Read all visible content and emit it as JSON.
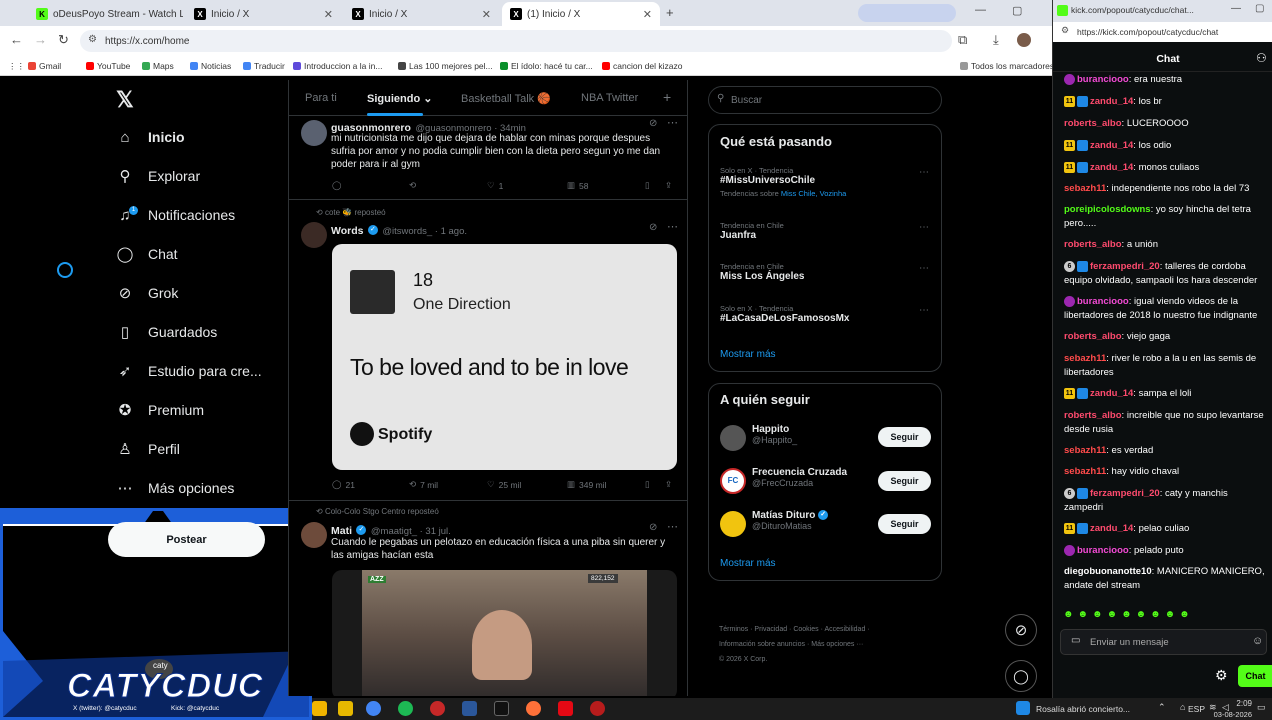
{
  "browser": {
    "tabs": [
      {
        "label": "oDeusPoyo Stream - Watch Liv",
        "color": "#53fc18",
        "glyph": "K"
      },
      {
        "label": "Inicio / X",
        "color": "#000000",
        "glyph": "X"
      },
      {
        "label": "Inicio / X",
        "color": "#000000",
        "glyph": "X"
      },
      {
        "label": "(1) Inicio / X",
        "color": "#000000",
        "glyph": "X"
      }
    ],
    "url": "https://x.com/home",
    "bookmarks": [
      {
        "label": "Gmail",
        "color": "#ea4335"
      },
      {
        "label": "YouTube",
        "color": "#ff0000"
      },
      {
        "label": "Maps",
        "color": "#34a853"
      },
      {
        "label": "Noticias",
        "color": "#4285f4"
      },
      {
        "label": "Traducir",
        "color": "#4285f4"
      },
      {
        "label": "Introduccion a la in...",
        "color": "#5f4bdb"
      },
      {
        "label": "Las 100 mejores pel...",
        "color": "#444444"
      },
      {
        "label": "El ídolo: hacé tu car...",
        "color": "#0a8f2a"
      },
      {
        "label": "cancion del kizazo",
        "color": "#ff0000"
      }
    ],
    "bookmarks_all": "Todos los marcadores"
  },
  "x_nav": {
    "items": [
      {
        "label": "Inicio",
        "icon": "home-icon",
        "glyph": "⌂"
      },
      {
        "label": "Explorar",
        "icon": "search-icon",
        "glyph": "⚲"
      },
      {
        "label": "Notificaciones",
        "icon": "bell-icon",
        "glyph": "♫"
      },
      {
        "label": "Chat",
        "icon": "chat-icon",
        "glyph": "◯"
      },
      {
        "label": "Grok",
        "icon": "grok-icon",
        "glyph": "⊘"
      },
      {
        "label": "Guardados",
        "icon": "bookmark-icon",
        "glyph": "▯"
      },
      {
        "label": "Estudio para cre...",
        "icon": "rocket-icon",
        "glyph": "➶"
      },
      {
        "label": "Premium",
        "icon": "premium-icon",
        "glyph": "✪"
      },
      {
        "label": "Perfil",
        "icon": "profile-icon",
        "glyph": "♙"
      },
      {
        "label": "Más opciones",
        "icon": "more-icon",
        "glyph": "⋯"
      }
    ],
    "post_button": "Postear",
    "notification_count": "1"
  },
  "stream": {
    "brand": "CATYCDUC",
    "streamer": "caty",
    "footer_twitter": "X (twitter): @catycduc",
    "footer_kick": "Kick: @catycduc"
  },
  "feed": {
    "tabs": [
      "Para ti",
      "Siguiendo",
      "Basketball Talk 🏀",
      "NBA Twitter",
      "+"
    ],
    "tweets": [
      {
        "name": "guasonmonrero",
        "handle": "@guasonmonrero · 34min",
        "text": "mi nutricionista me dijo que dejara de hablar con minas porque despues sufria por amor y no podia cumplir bien con la dieta pero segun yo me dan poder para ir al gym",
        "replies": "",
        "retweets": "",
        "likes": "1",
        "views": "58"
      },
      {
        "repost": "cote 🐝 reposteó",
        "name": "Words",
        "handle": "@itswords_ · 1 ago.",
        "card_number": "18",
        "card_artist": "One Direction",
        "card_lyric": "To be loved and to be in love",
        "card_brand": "Spotify",
        "replies": "21",
        "retweets": "7 mil",
        "likes": "25 mil",
        "views": "349 mil"
      },
      {
        "repost": "Colo-Colo Stgo Centro reposteó",
        "name": "Mati",
        "handle": "@maatigt_ · 31 jul.",
        "text": "Cuando le pegabas un pelotazo en educación física a una piba sin querer y las amigas hacían esta",
        "media_counter": "822,152"
      }
    ]
  },
  "right": {
    "search_placeholder": "Buscar",
    "trends_title": "Qué está pasando",
    "trends": [
      {
        "meta": "Solo en X · Tendencia",
        "title": "#MissUniversoChile",
        "sub": "Tendencias sobre ",
        "sub_link": "Miss Chile, Vozinha"
      },
      {
        "meta": "Tendencia en Chile",
        "title": "Juanfra"
      },
      {
        "meta": "Tendencia en Chile",
        "title": "Miss Los Ángeles"
      },
      {
        "meta": "Solo en X · Tendencia",
        "title": "#LaCasaDeLosFamososMx"
      }
    ],
    "show_more": "Mostrar más",
    "follow_title": "A quién seguir",
    "follow": [
      {
        "name": "Happito",
        "handle": "@Happito_",
        "verified": false
      },
      {
        "name": "Frecuencia Cruzada",
        "handle": "@FrecCruzada",
        "verified": false
      },
      {
        "name": "Matías Dituro",
        "handle": "@DituroMatias",
        "verified": true
      }
    ],
    "follow_button": "Seguir",
    "footer": [
      "Términos",
      "Privacidad",
      "Cookies",
      "Accesibilidad",
      "Información sobre anuncios",
      "Más opciones ···",
      "© 2026 X Corp."
    ]
  },
  "kick": {
    "url": "https://kick.com/popout/catycduc/chat",
    "title_bar": "kick.com/popout/catycduc/chat...",
    "header": "Chat",
    "messages": [
      {
        "user": "buranciooo",
        "color": "#f34bd5",
        "badges": [
          "sub"
        ],
        "text": "era nuestra"
      },
      {
        "user": "zandu_14",
        "color": "#ff4b6e",
        "badges": [
          "11",
          "vip"
        ],
        "text": "los br"
      },
      {
        "user": "roberts_albo",
        "color": "#ff4b6e",
        "badges": [],
        "text": "LUCEROOOO"
      },
      {
        "user": "zandu_14",
        "color": "#ff4b6e",
        "badges": [
          "11",
          "vip"
        ],
        "text": "los odio"
      },
      {
        "user": "zandu_14",
        "color": "#ff4b6e",
        "badges": [
          "11",
          "vip"
        ],
        "text": "monos culiaos"
      },
      {
        "user": "sebazh11",
        "color": "#ff4b4b",
        "badges": [],
        "text": "independiente nos robo la del 73"
      },
      {
        "user": "poreipicolosdowns",
        "color": "#53fc18",
        "badges": [],
        "text": "yo soy hincha del tetra pero....."
      },
      {
        "user": "roberts_albo",
        "color": "#ff4b6e",
        "badges": [],
        "text": "a unión"
      },
      {
        "user": "ferzampedri_20",
        "color": "#ff4b6e",
        "badges": [
          "6",
          "vip"
        ],
        "text": "talleres de cordoba equipo olvidado, sampaoli los hara descender"
      },
      {
        "user": "buranciooo",
        "color": "#f34bd5",
        "badges": [
          "sub"
        ],
        "text": "igual viendo videos de la libertadores de 2018 lo nuestro fue indignante"
      },
      {
        "user": "roberts_albo",
        "color": "#ff4b6e",
        "badges": [],
        "text": "viejo gaga"
      },
      {
        "user": "sebazh11",
        "color": "#ff4b4b",
        "badges": [],
        "text": "river le robo a la u en las semis de libertadores"
      },
      {
        "user": "zandu_14",
        "color": "#ff4b6e",
        "badges": [
          "11",
          "vip"
        ],
        "text": "sampa el loli"
      },
      {
        "user": "roberts_albo",
        "color": "#ff4b6e",
        "badges": [],
        "text": "increible que no supo levantarse desde rusia"
      },
      {
        "user": "sebazh11",
        "color": "#ff4b4b",
        "badges": [],
        "text": "es verdad"
      },
      {
        "user": "sebazh11",
        "color": "#ff4b4b",
        "badges": [],
        "text": "hay vidio chaval"
      },
      {
        "user": "ferzampedri_20",
        "color": "#ff4b6e",
        "badges": [
          "6",
          "vip"
        ],
        "text": "caty y manchis zampedri"
      },
      {
        "user": "zandu_14",
        "color": "#ff4b6e",
        "badges": [
          "11",
          "vip"
        ],
        "text": "pelao culiao"
      },
      {
        "user": "buranciooo",
        "color": "#f34bd5",
        "badges": [
          "sub"
        ],
        "text": "pelado puto"
      },
      {
        "user": "diegobuonanotte10",
        "color": "#ffffff",
        "badges": [],
        "text": "MANICERO MANICERO, andate del stream"
      }
    ],
    "input_placeholder": "Enviar un mensaje",
    "send_button": "Chat"
  },
  "taskbar": {
    "weather": "Rosalía abrió concierto...",
    "lang": "ESP",
    "time": "2:09",
    "date": "03-08-2026"
  }
}
